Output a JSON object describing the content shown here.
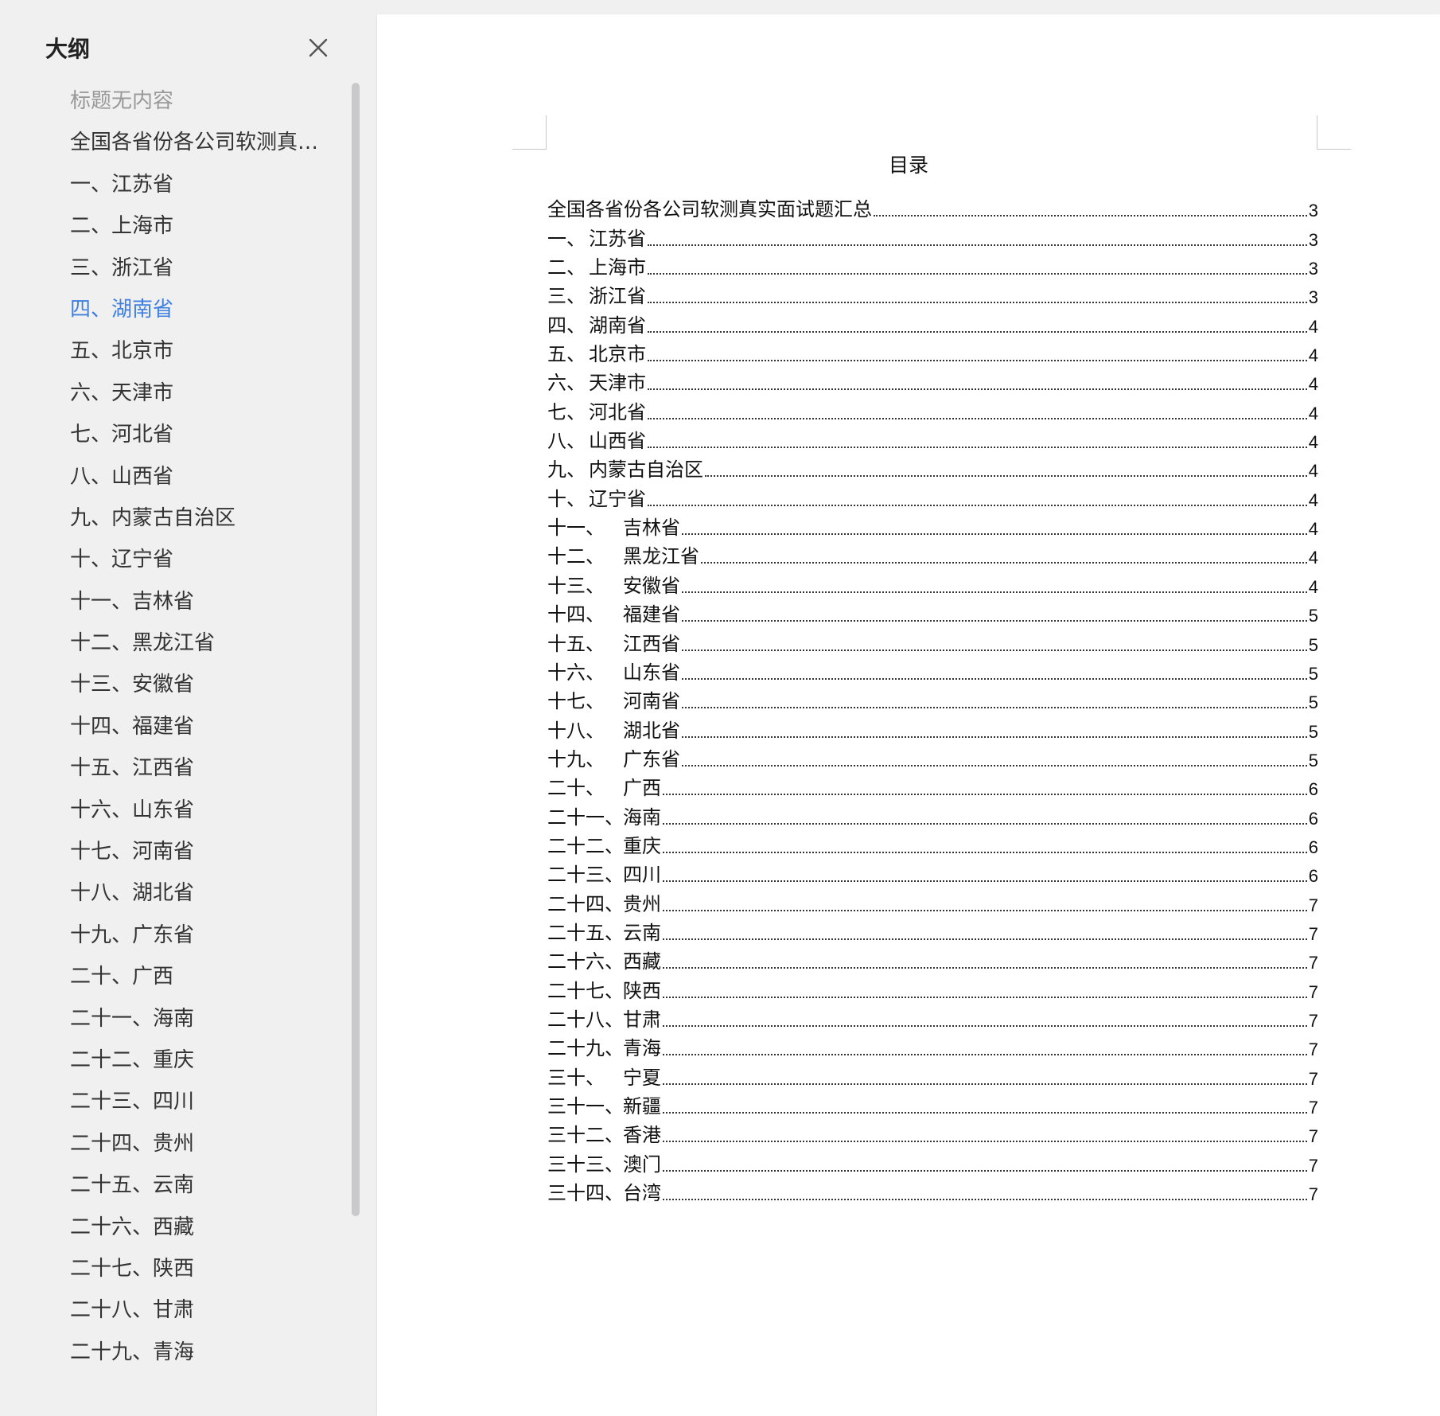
{
  "sidebar": {
    "title": "大纲",
    "items": [
      {
        "label": "标题无内容",
        "state": "muted"
      },
      {
        "label": "全国各省份各公司软测真实...",
        "state": "normal"
      },
      {
        "label": "一、江苏省",
        "state": "normal"
      },
      {
        "label": "二、上海市",
        "state": "normal"
      },
      {
        "label": "三、浙江省",
        "state": "normal"
      },
      {
        "label": "四、湖南省",
        "state": "active"
      },
      {
        "label": "五、北京市",
        "state": "normal"
      },
      {
        "label": "六、天津市",
        "state": "normal"
      },
      {
        "label": "七、河北省",
        "state": "normal"
      },
      {
        "label": "八、山西省",
        "state": "normal"
      },
      {
        "label": "九、内蒙古自治区",
        "state": "normal"
      },
      {
        "label": "十、辽宁省",
        "state": "normal"
      },
      {
        "label": "十一、吉林省",
        "state": "normal"
      },
      {
        "label": "十二、黑龙江省",
        "state": "normal"
      },
      {
        "label": "十三、安徽省",
        "state": "normal"
      },
      {
        "label": "十四、福建省",
        "state": "normal"
      },
      {
        "label": "十五、江西省",
        "state": "normal"
      },
      {
        "label": "十六、山东省",
        "state": "normal"
      },
      {
        "label": "十七、河南省",
        "state": "normal"
      },
      {
        "label": "十八、湖北省",
        "state": "normal"
      },
      {
        "label": "十九、广东省",
        "state": "normal"
      },
      {
        "label": "二十、广西",
        "state": "normal"
      },
      {
        "label": "二十一、海南",
        "state": "normal"
      },
      {
        "label": "二十二、重庆",
        "state": "normal"
      },
      {
        "label": "二十三、四川",
        "state": "normal"
      },
      {
        "label": "二十四、贵州",
        "state": "normal"
      },
      {
        "label": "二十五、云南",
        "state": "normal"
      },
      {
        "label": "二十六、西藏",
        "state": "normal"
      },
      {
        "label": "二十七、陕西",
        "state": "normal"
      },
      {
        "label": "二十八、甘肃",
        "state": "normal"
      },
      {
        "label": "二十九、青海",
        "state": "normal"
      }
    ]
  },
  "colors": {
    "active": "#3e7fe0",
    "muted": "#999999",
    "sidebar_bg": "#f0f0f1",
    "page_bg": "#ffffff"
  },
  "icons": {
    "close": "close-icon"
  },
  "document": {
    "toc_title": "目录",
    "entries": [
      {
        "num": "",
        "label": "全国各省份各公司软测真实面试题汇总",
        "page": "3"
      },
      {
        "num": "一、",
        "label": "江苏省",
        "page": "3"
      },
      {
        "num": "二、",
        "label": "上海市",
        "page": "3"
      },
      {
        "num": "三、",
        "label": "浙江省",
        "page": "3"
      },
      {
        "num": "四、",
        "label": "湖南省",
        "page": "4"
      },
      {
        "num": "五、",
        "label": "北京市",
        "page": "4"
      },
      {
        "num": "六、",
        "label": "天津市",
        "page": "4"
      },
      {
        "num": "七、",
        "label": "河北省",
        "page": "4"
      },
      {
        "num": "八、",
        "label": "山西省",
        "page": "4"
      },
      {
        "num": "九、",
        "label": "内蒙古自治区",
        "page": "4"
      },
      {
        "num": "十、",
        "label": "辽宁省",
        "page": "4"
      },
      {
        "num": "十一、",
        "label": "吉林省",
        "page": "4"
      },
      {
        "num": "十二、",
        "label": "黑龙江省",
        "page": "4"
      },
      {
        "num": "十三、",
        "label": "安徽省",
        "page": "4"
      },
      {
        "num": "十四、",
        "label": "福建省",
        "page": "5"
      },
      {
        "num": "十五、",
        "label": "江西省",
        "page": "5"
      },
      {
        "num": "十六、",
        "label": "山东省",
        "page": "5"
      },
      {
        "num": "十七、",
        "label": "河南省",
        "page": "5"
      },
      {
        "num": "十八、",
        "label": "湖北省",
        "page": "5"
      },
      {
        "num": "十九、",
        "label": "广东省",
        "page": "5"
      },
      {
        "num": "二十、",
        "label": "广西",
        "page": "6"
      },
      {
        "num": "二十一、",
        "label": "海南",
        "page": "6"
      },
      {
        "num": "二十二、",
        "label": "重庆",
        "page": "6"
      },
      {
        "num": "二十三、",
        "label": "四川",
        "page": "6"
      },
      {
        "num": "二十四、",
        "label": "贵州",
        "page": "7"
      },
      {
        "num": "二十五、",
        "label": "云南",
        "page": "7"
      },
      {
        "num": "二十六、",
        "label": "西藏",
        "page": "7"
      },
      {
        "num": "二十七、",
        "label": "陕西",
        "page": "7"
      },
      {
        "num": "二十八、",
        "label": "甘肃",
        "page": "7"
      },
      {
        "num": "二十九、",
        "label": "青海",
        "page": "7"
      },
      {
        "num": "三十、",
        "label": "宁夏",
        "page": "7"
      },
      {
        "num": "三十一、",
        "label": "新疆",
        "page": "7"
      },
      {
        "num": "三十二、",
        "label": "香港",
        "page": "7"
      },
      {
        "num": "三十三、",
        "label": "澳门",
        "page": "7"
      },
      {
        "num": "三十四、",
        "label": "台湾",
        "page": "7"
      }
    ]
  }
}
